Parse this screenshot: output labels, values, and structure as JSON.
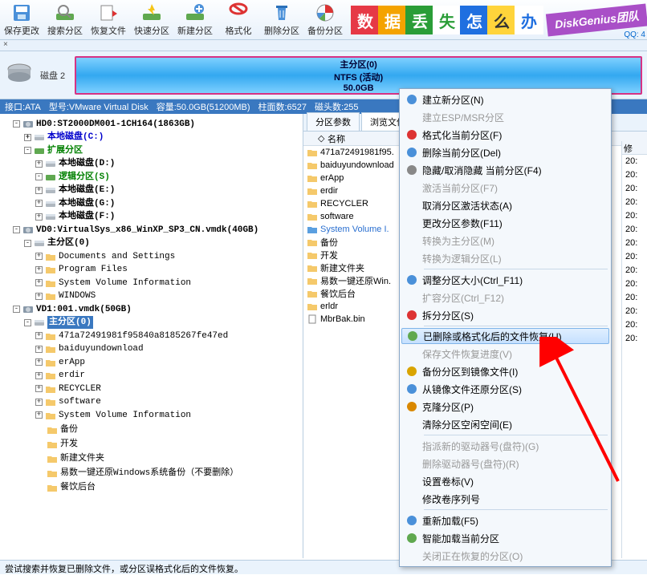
{
  "toolbar": [
    {
      "id": "save",
      "label": "保存更改"
    },
    {
      "id": "search",
      "label": "搜索分区"
    },
    {
      "id": "recover",
      "label": "恢复文件"
    },
    {
      "id": "quick",
      "label": "快速分区"
    },
    {
      "id": "new",
      "label": "新建分区"
    },
    {
      "id": "format",
      "label": "格式化"
    },
    {
      "id": "delete",
      "label": "删除分区"
    },
    {
      "id": "backup",
      "label": "备份分区"
    }
  ],
  "banner": {
    "tiles": [
      {
        "char": "数",
        "bg": "#e63946"
      },
      {
        "char": "据",
        "bg": "#f4a300"
      },
      {
        "char": "丢",
        "bg": "#2a9d37"
      },
      {
        "char": "失",
        "bg": "#fff",
        "fg": "#2a9d37"
      },
      {
        "char": "怎",
        "bg": "#1f6fe0"
      },
      {
        "char": "么",
        "bg": "#ffd43b",
        "fg": "#333"
      },
      {
        "char": "办",
        "bg": "#fff",
        "fg": "#1f6fe0"
      }
    ],
    "brand": "DiskGenius团队",
    "qq": "QQ: 4"
  },
  "closebtn": "×",
  "diskbar": {
    "label": "磁盘 2"
  },
  "partition": {
    "l1": "主分区(0)",
    "l2": "NTFS (活动)",
    "l3": "50.0GB"
  },
  "infobar": {
    "iface": "接口:ATA",
    "model": "型号:VMware Virtual Disk",
    "cap": "容量:50.0GB(51200MB)",
    "cyl": "柱面数:6527",
    "heads": "磁头数:255"
  },
  "tree": {
    "hd0": "HD0:ST2000DM001-1CH164(1863GB)",
    "local": "本地磁盘(C:)",
    "ext": "扩展分区",
    "d": "本地磁盘(D:)",
    "log": "逻辑分区(S)",
    "e": "本地磁盘(E:)",
    "g": "本地磁盘(G:)",
    "f": "本地磁盘(F:)",
    "vd0": "VD0:VirtualSys_x86_WinXP_SP3_CN.vmdk(40GB)",
    "vd0main": "主分区(0)",
    "docs": "Documents and Settings",
    "prog": "Program Files",
    "svi": "System Volume Information",
    "win": "WINDOWS",
    "vd1": "VD1:001.vmdk(50GB)",
    "vd1main": "主分区(0)",
    "c1": "471a72491981f95840a8185267fe47ed",
    "c2": "baiduyundownload",
    "c3": "erApp",
    "c4": "erdir",
    "c5": "RECYCLER",
    "c6": "software",
    "c7": "System Volume Information",
    "c8": "备份",
    "c9": "开发",
    "c10": "新建文件夹",
    "c11": "易数一键还原Windows系统备份（不要删除）",
    "c12": "餐饮后台"
  },
  "tabs": {
    "params": "分区参数",
    "browse": "浏览文件"
  },
  "filehdr": {
    "name": "名称"
  },
  "files": [
    {
      "t": "folder",
      "n": "471a72491981f95."
    },
    {
      "t": "folder",
      "n": "baiduyundownload"
    },
    {
      "t": "folder",
      "n": "erApp"
    },
    {
      "t": "folder",
      "n": "erdir"
    },
    {
      "t": "folder",
      "n": "RECYCLER"
    },
    {
      "t": "folder",
      "n": "software"
    },
    {
      "t": "folder",
      "n": "System Volume I.",
      "blue": true
    },
    {
      "t": "folder",
      "n": "备份"
    },
    {
      "t": "folder",
      "n": "开发"
    },
    {
      "t": "folder",
      "n": "新建文件夹"
    },
    {
      "t": "folder",
      "n": "易数一键还原Win."
    },
    {
      "t": "folder",
      "n": "餐饮后台"
    },
    {
      "t": "folder",
      "n": "erldr"
    },
    {
      "t": "file",
      "n": "MbrBak.bin"
    }
  ],
  "menu": [
    {
      "icon": "new",
      "t": "建立新分区(N)"
    },
    {
      "icon": "",
      "t": "建立ESP/MSR分区",
      "dis": true
    },
    {
      "icon": "forbid",
      "t": "格式化当前分区(F)"
    },
    {
      "icon": "del",
      "t": "删除当前分区(Del)"
    },
    {
      "icon": "hide",
      "t": "隐藏/取消隐藏 当前分区(F4)"
    },
    {
      "icon": "",
      "t": "激活当前分区(F7)",
      "dis": true
    },
    {
      "icon": "",
      "t": "取消分区激活状态(A)"
    },
    {
      "icon": "",
      "t": "更改分区参数(F11)"
    },
    {
      "icon": "",
      "t": "转换为主分区(M)",
      "dis": true
    },
    {
      "icon": "",
      "t": "转换为逻辑分区(L)",
      "dis": true
    },
    {
      "sep": true
    },
    {
      "icon": "resize",
      "t": "调整分区大小(Ctrl_F11)"
    },
    {
      "icon": "",
      "t": "扩容分区(Ctrl_F12)",
      "dis": true
    },
    {
      "icon": "split",
      "t": "拆分分区(S)"
    },
    {
      "sep": true
    },
    {
      "icon": "recover",
      "t": "已删除或格式化后的文件恢复(U)",
      "hl": true
    },
    {
      "icon": "",
      "t": "保存文件恢复进度(V)",
      "dis": true
    },
    {
      "icon": "backup",
      "t": "备份分区到镜像文件(I)"
    },
    {
      "icon": "restore",
      "t": "从镜像文件还原分区(S)"
    },
    {
      "icon": "clone",
      "t": "克隆分区(P)"
    },
    {
      "icon": "",
      "t": "清除分区空闲空间(E)"
    },
    {
      "sep": true
    },
    {
      "icon": "",
      "t": "指派新的驱动器号(盘符)(G)",
      "dis": true
    },
    {
      "icon": "",
      "t": "删除驱动器号(盘符)(R)",
      "dis": true
    },
    {
      "icon": "",
      "t": "设置卷标(V)"
    },
    {
      "icon": "",
      "t": "修改卷序列号"
    },
    {
      "sep": true
    },
    {
      "icon": "reload",
      "t": "重新加载(F5)"
    },
    {
      "icon": "smart",
      "t": "智能加载当前分区"
    },
    {
      "icon": "",
      "t": "关闭正在恢复的分区(O)",
      "dis": true
    }
  ],
  "rightcol": {
    "hdr": "修",
    "vals": [
      "20:",
      "20:",
      "20:",
      "20:",
      "20:",
      "20:",
      "20:",
      "20:",
      "20:",
      "20:",
      "20:",
      "20:",
      "20:",
      "20:"
    ]
  },
  "status": "尝试搜索并恢复已删除文件，或分区误格式化后的文件恢复。"
}
